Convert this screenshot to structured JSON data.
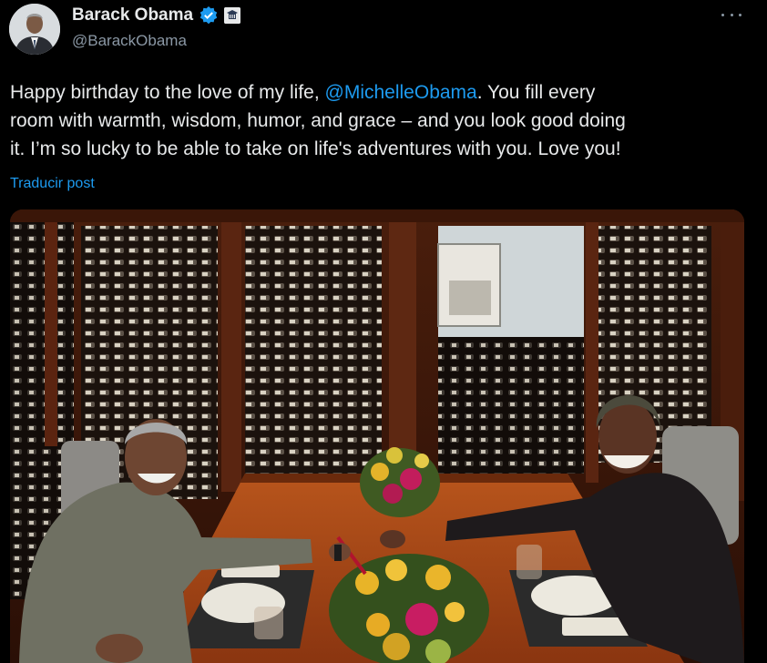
{
  "author": {
    "name": "Barack Obama",
    "handle": "@BarackObama",
    "verified_icon": "verified-badge-icon",
    "affiliation_icon": "government-seal-icon",
    "avatar_icon": "profile-photo"
  },
  "post": {
    "line1_before": "Happy birthday to the love of my life, ",
    "mention": "@MichelleObama",
    "line1_after": ". You fill every",
    "line2": "room with warmth, wisdom, humor, and grace – and you look good doing",
    "line3": "it. I’m so lucky to be able to take on life's adventures with you. Love you!",
    "translate_label": "Traducir post"
  },
  "media": {
    "description_icon": "photo"
  },
  "colors": {
    "background": "#000000",
    "text": "#e7e9ea",
    "secondary": "#8b98a5",
    "link": "#1d9bf0"
  }
}
